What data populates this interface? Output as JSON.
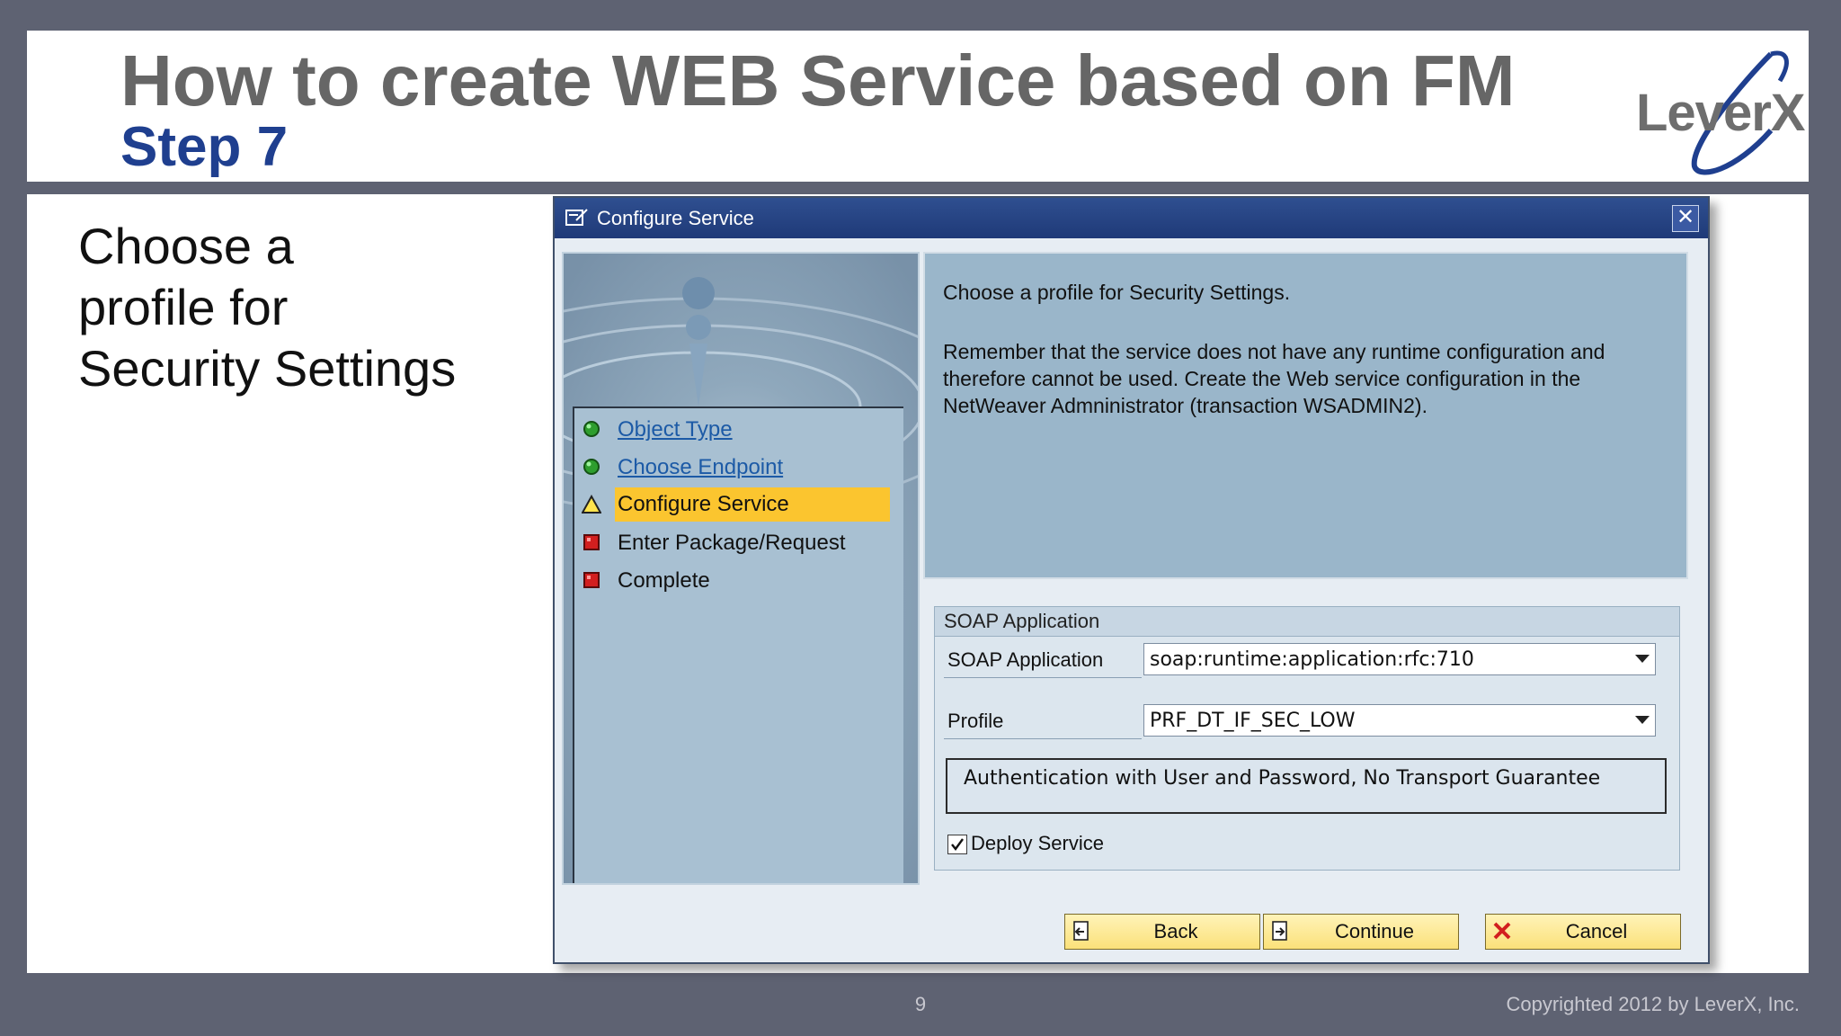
{
  "slide": {
    "title": "How to create WEB Service based on FM",
    "subtitle": "Step 7",
    "logo_text": "LeverX",
    "side_text": [
      "Choose  a",
      "profile  for",
      "Security Settings"
    ],
    "page_number": "9",
    "copyright": "Copyrighted 2012 by LeverX, Inc."
  },
  "dialog": {
    "title": "Configure Service",
    "close_label": "✕",
    "steps": [
      {
        "label": "Object Type",
        "status": "done",
        "link": true
      },
      {
        "label": "Choose Endpoint",
        "status": "done",
        "link": true
      },
      {
        "label": "Configure Service",
        "status": "current",
        "link": false
      },
      {
        "label": "Enter Package/Request",
        "status": "todo",
        "link": false
      },
      {
        "label": "Complete",
        "status": "todo",
        "link": false
      }
    ],
    "info": {
      "line1": "Choose a profile for Security Settings.",
      "paragraph": "Remember that the service does not have any runtime configuration and therefore cannot be used. Create the Web service configuration in the NetWeaver Admninistrator (transaction WSADMIN2)."
    },
    "soap_group": {
      "title": "SOAP Application",
      "soap_application_label": "SOAP Application",
      "soap_application_value": "soap:runtime:application:rfc:710",
      "profile_label": "Profile",
      "profile_value": "PRF_DT_IF_SEC_LOW",
      "profile_description": "Authentication with User and Password, No Transport Guarantee",
      "deploy_label": "Deploy Service",
      "deploy_checked": true
    },
    "buttons": {
      "back": "Back",
      "continue": "Continue",
      "cancel": "Cancel"
    }
  },
  "colors": {
    "title_gray": "#666666",
    "subtitle_blue": "#1f3f8f",
    "titlebar_blue": "#2f4f90",
    "current_step": "#fbc52f",
    "status_done": "#2e9e2e",
    "status_todo": "#d21f1f"
  },
  "icons": {
    "done": "green-circle-icon",
    "current": "yellow-triangle-icon",
    "todo": "red-square-icon"
  }
}
